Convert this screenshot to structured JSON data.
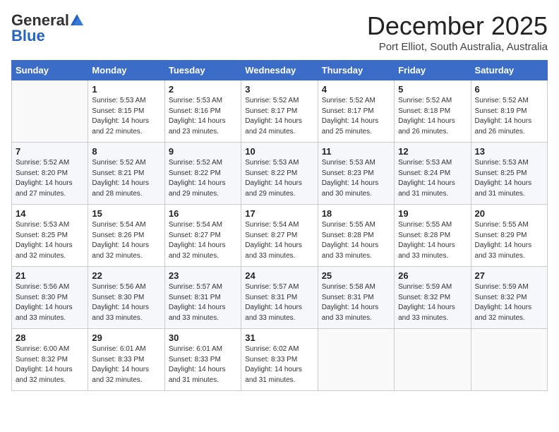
{
  "logo": {
    "general": "General",
    "blue": "Blue"
  },
  "title": "December 2025",
  "location": "Port Elliot, South Australia, Australia",
  "weekdays": [
    "Sunday",
    "Monday",
    "Tuesday",
    "Wednesday",
    "Thursday",
    "Friday",
    "Saturday"
  ],
  "weeks": [
    [
      {
        "day": "",
        "info": ""
      },
      {
        "day": "1",
        "info": "Sunrise: 5:53 AM\nSunset: 8:15 PM\nDaylight: 14 hours\nand 22 minutes."
      },
      {
        "day": "2",
        "info": "Sunrise: 5:53 AM\nSunset: 8:16 PM\nDaylight: 14 hours\nand 23 minutes."
      },
      {
        "day": "3",
        "info": "Sunrise: 5:52 AM\nSunset: 8:17 PM\nDaylight: 14 hours\nand 24 minutes."
      },
      {
        "day": "4",
        "info": "Sunrise: 5:52 AM\nSunset: 8:17 PM\nDaylight: 14 hours\nand 25 minutes."
      },
      {
        "day": "5",
        "info": "Sunrise: 5:52 AM\nSunset: 8:18 PM\nDaylight: 14 hours\nand 26 minutes."
      },
      {
        "day": "6",
        "info": "Sunrise: 5:52 AM\nSunset: 8:19 PM\nDaylight: 14 hours\nand 26 minutes."
      }
    ],
    [
      {
        "day": "7",
        "info": "Sunrise: 5:52 AM\nSunset: 8:20 PM\nDaylight: 14 hours\nand 27 minutes."
      },
      {
        "day": "8",
        "info": "Sunrise: 5:52 AM\nSunset: 8:21 PM\nDaylight: 14 hours\nand 28 minutes."
      },
      {
        "day": "9",
        "info": "Sunrise: 5:52 AM\nSunset: 8:22 PM\nDaylight: 14 hours\nand 29 minutes."
      },
      {
        "day": "10",
        "info": "Sunrise: 5:53 AM\nSunset: 8:22 PM\nDaylight: 14 hours\nand 29 minutes."
      },
      {
        "day": "11",
        "info": "Sunrise: 5:53 AM\nSunset: 8:23 PM\nDaylight: 14 hours\nand 30 minutes."
      },
      {
        "day": "12",
        "info": "Sunrise: 5:53 AM\nSunset: 8:24 PM\nDaylight: 14 hours\nand 31 minutes."
      },
      {
        "day": "13",
        "info": "Sunrise: 5:53 AM\nSunset: 8:25 PM\nDaylight: 14 hours\nand 31 minutes."
      }
    ],
    [
      {
        "day": "14",
        "info": "Sunrise: 5:53 AM\nSunset: 8:25 PM\nDaylight: 14 hours\nand 32 minutes."
      },
      {
        "day": "15",
        "info": "Sunrise: 5:54 AM\nSunset: 8:26 PM\nDaylight: 14 hours\nand 32 minutes."
      },
      {
        "day": "16",
        "info": "Sunrise: 5:54 AM\nSunset: 8:27 PM\nDaylight: 14 hours\nand 32 minutes."
      },
      {
        "day": "17",
        "info": "Sunrise: 5:54 AM\nSunset: 8:27 PM\nDaylight: 14 hours\nand 33 minutes."
      },
      {
        "day": "18",
        "info": "Sunrise: 5:55 AM\nSunset: 8:28 PM\nDaylight: 14 hours\nand 33 minutes."
      },
      {
        "day": "19",
        "info": "Sunrise: 5:55 AM\nSunset: 8:28 PM\nDaylight: 14 hours\nand 33 minutes."
      },
      {
        "day": "20",
        "info": "Sunrise: 5:55 AM\nSunset: 8:29 PM\nDaylight: 14 hours\nand 33 minutes."
      }
    ],
    [
      {
        "day": "21",
        "info": "Sunrise: 5:56 AM\nSunset: 8:30 PM\nDaylight: 14 hours\nand 33 minutes."
      },
      {
        "day": "22",
        "info": "Sunrise: 5:56 AM\nSunset: 8:30 PM\nDaylight: 14 hours\nand 33 minutes."
      },
      {
        "day": "23",
        "info": "Sunrise: 5:57 AM\nSunset: 8:31 PM\nDaylight: 14 hours\nand 33 minutes."
      },
      {
        "day": "24",
        "info": "Sunrise: 5:57 AM\nSunset: 8:31 PM\nDaylight: 14 hours\nand 33 minutes."
      },
      {
        "day": "25",
        "info": "Sunrise: 5:58 AM\nSunset: 8:31 PM\nDaylight: 14 hours\nand 33 minutes."
      },
      {
        "day": "26",
        "info": "Sunrise: 5:59 AM\nSunset: 8:32 PM\nDaylight: 14 hours\nand 33 minutes."
      },
      {
        "day": "27",
        "info": "Sunrise: 5:59 AM\nSunset: 8:32 PM\nDaylight: 14 hours\nand 32 minutes."
      }
    ],
    [
      {
        "day": "28",
        "info": "Sunrise: 6:00 AM\nSunset: 8:32 PM\nDaylight: 14 hours\nand 32 minutes."
      },
      {
        "day": "29",
        "info": "Sunrise: 6:01 AM\nSunset: 8:33 PM\nDaylight: 14 hours\nand 32 minutes."
      },
      {
        "day": "30",
        "info": "Sunrise: 6:01 AM\nSunset: 8:33 PM\nDaylight: 14 hours\nand 31 minutes."
      },
      {
        "day": "31",
        "info": "Sunrise: 6:02 AM\nSunset: 8:33 PM\nDaylight: 14 hours\nand 31 minutes."
      },
      {
        "day": "",
        "info": ""
      },
      {
        "day": "",
        "info": ""
      },
      {
        "day": "",
        "info": ""
      }
    ]
  ]
}
